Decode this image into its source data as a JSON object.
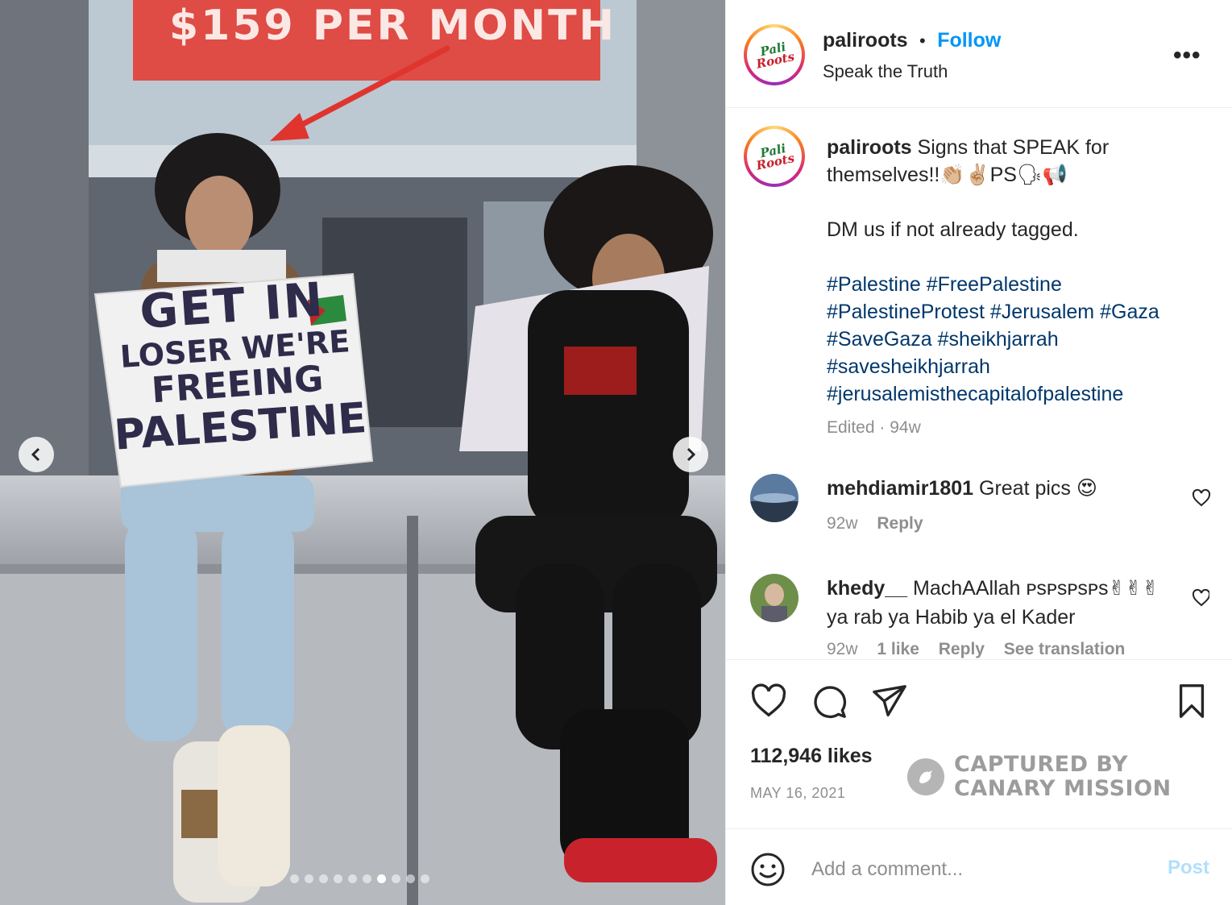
{
  "photo": {
    "banner_text": "$159 PER MONTH",
    "sign": {
      "line1": "GET IN",
      "line2": "LOSER WE'RE",
      "line3": "FREEING",
      "line4": "PALESTINE"
    },
    "prev_icon": "chevron-left-icon",
    "next_icon": "chevron-right-icon",
    "carousel": {
      "total": 10,
      "active_index": 6
    }
  },
  "header": {
    "username": "paliroots",
    "separator": "•",
    "follow_label": "Follow",
    "subtitle": "Speak the Truth",
    "more_label": "•••",
    "avatar_logo_top": "Pali",
    "avatar_logo_bottom": "Roots"
  },
  "caption": {
    "username": "paliroots",
    "text": "Signs that SPEAK for themselves!!👏🏼✌🏼PS🗣📢",
    "line2": "DM us if not already tagged.",
    "hashtags": [
      "#Palestine",
      "#FreePalestine",
      "#PalestineProtest",
      "#Jerusalem",
      "#Gaza",
      "#SaveGaza",
      "#sheikhjarrah",
      "#savesheikhjarrah",
      "#jerusalemisthecapitalofpalestine"
    ],
    "meta": "Edited · 94w"
  },
  "comments": [
    {
      "username": "mehdiamir1801",
      "text": "Great pics 😍",
      "age": "92w",
      "reply_label": "Reply"
    },
    {
      "username": "khedy__",
      "text": "MachAAllah ᴘsᴘsᴘsᴘs✌✌✌",
      "text2": "ya rab ya Habib ya el Kader",
      "age": "92w",
      "likes_label": "1 like",
      "reply_label": "Reply",
      "translate_label": "See translation"
    }
  ],
  "actions": {
    "like_icon": "heart-icon",
    "comment_icon": "comment-icon",
    "share_icon": "paper-plane-icon",
    "save_icon": "bookmark-icon"
  },
  "likes": "112,946 likes",
  "date": "MAY 16, 2021",
  "watermark": {
    "line1": "CAPTURED BY",
    "line2": "CANARY MISSION"
  },
  "comment_box": {
    "placeholder": "Add a comment...",
    "post_label": "Post",
    "emoji_icon": "smiley-icon"
  },
  "colors": {
    "link_blue": "#0095f6",
    "hashtag": "#00376b",
    "muted": "#8e8e8e",
    "post_disabled": "#b2dffc"
  }
}
